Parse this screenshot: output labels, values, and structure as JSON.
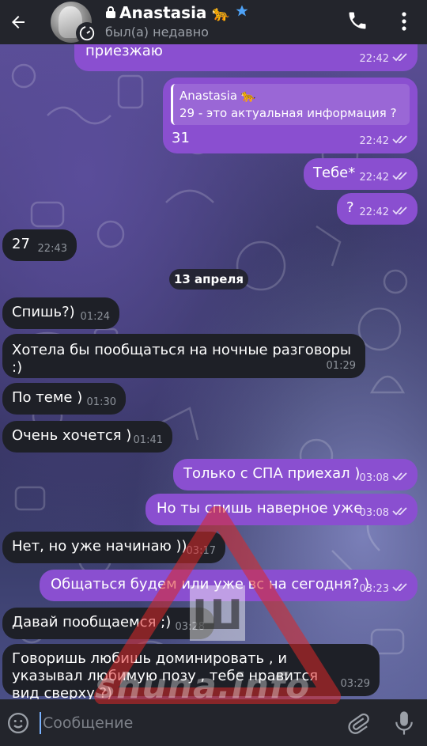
{
  "header": {
    "contact_name": "Anastasia",
    "name_emoji": "🐆",
    "status": "был(а) недавно",
    "icons": {
      "back": "arrow-left-icon",
      "lock": "lock-icon",
      "verified": "star-icon",
      "call": "phone-icon",
      "menu": "more-vertical-icon",
      "timer": "timer-icon"
    }
  },
  "messages": [
    {
      "dir": "out",
      "text": "приезжаю",
      "time": "22:42",
      "read": true
    },
    {
      "dir": "out",
      "reply_name": "Anastasia 🐆",
      "reply_text": "29 - это актуальная информация ?",
      "text": "31",
      "time": "22:42",
      "read": true
    },
    {
      "dir": "out",
      "text": "Тебе*",
      "time": "22:42",
      "read": true
    },
    {
      "dir": "out",
      "text": "?",
      "time": "22:42",
      "read": true
    },
    {
      "dir": "in",
      "text": "27",
      "time": "22:43"
    },
    {
      "dir": "in",
      "text": "Спишь?)",
      "time": "01:24"
    },
    {
      "dir": "in",
      "text": "Хотела бы пообщаться на ночные разговоры :)",
      "time": "01:29"
    },
    {
      "dir": "in",
      "text": "По теме )",
      "time": "01:30"
    },
    {
      "dir": "in",
      "text": "Очень хочется )",
      "time": "01:41"
    },
    {
      "dir": "out",
      "text": "Только с СПА приехал )",
      "time": "03:08",
      "read": true
    },
    {
      "dir": "out",
      "text": "Но ты спишь наверное уже",
      "time": "03:08",
      "read": true
    },
    {
      "dir": "in",
      "text": "Нет, но уже начинаю ))",
      "time": "03:17"
    },
    {
      "dir": "out",
      "text": "Общаться будем или уже вс на сегодня? )",
      "time": "03:23",
      "read": true
    },
    {
      "dir": "in",
      "text": "Давай пообщаемся ;)",
      "time": "03:28"
    },
    {
      "dir": "in",
      "text": "Говоришь любишь доминировать , и указывал любимую позу , тебе нравится вид сверху ?)",
      "time": "03:29"
    }
  ],
  "date_separator": "13 апреля",
  "composer": {
    "placeholder": "Сообщение",
    "icons": {
      "emoji": "smiley-icon",
      "attach": "paperclip-icon",
      "mic": "microphone-icon"
    }
  },
  "watermark": {
    "logo_letter": "Ш",
    "site": "shuna.info"
  },
  "colors": {
    "outgoing": "#8a4fd0",
    "incoming": "#1e2027",
    "header": "#23252c"
  }
}
